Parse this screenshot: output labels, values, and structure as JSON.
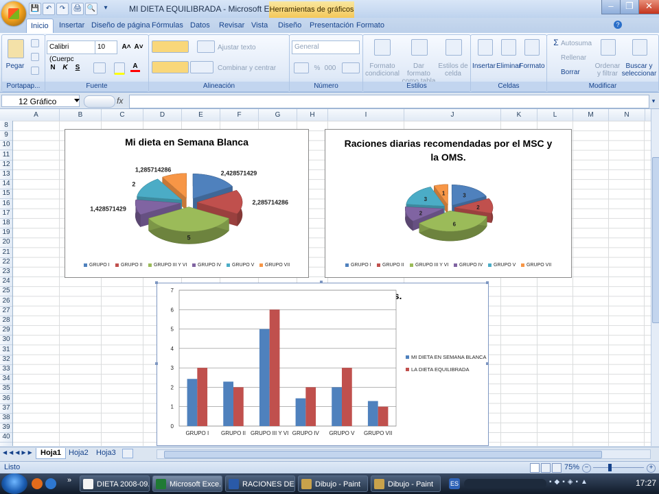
{
  "window": {
    "title": "MI DIETA EQUILIBRADA - Microsoft Excel",
    "contextual_tab": "Herramientas de gráficos",
    "minimize": "–",
    "restore": "❐",
    "close": "✕"
  },
  "qat": [
    "💾",
    "↶",
    "↷",
    "🖨",
    "🔍",
    "▾"
  ],
  "tabs": [
    "Inicio",
    "Insertar",
    "Diseño de página",
    "Fórmulas",
    "Datos",
    "Revisar",
    "Vista",
    "Diseño",
    "Presentación",
    "Formato"
  ],
  "ribbon": {
    "clipboard": {
      "label": "Portapap...",
      "paste": "Pegar"
    },
    "font": {
      "label": "Fuente",
      "font_name": "Calibri (Cuerpc",
      "font_size": "10",
      "grow": "A˄",
      "shrink": "A˅",
      "bold": "N",
      "italic": "K",
      "underline": "S"
    },
    "alignment": {
      "label": "Alineación",
      "wrap": "Ajustar texto",
      "merge": "Combinar y centrar"
    },
    "number": {
      "label": "Número",
      "format": "General",
      "percent": "%",
      "thousands": "000"
    },
    "styles": {
      "label": "Estilos",
      "cond_format": "Formato condicional",
      "table_format": "Dar formato como tabla",
      "cell_styles": "Estilos de celda"
    },
    "cells": {
      "label": "Celdas",
      "insert": "Insertar",
      "delete": "Eliminar",
      "format": "Formato"
    },
    "edit": {
      "label": "Modificar",
      "autosum": "Autosuma",
      "fill": "Rellenar",
      "clear": "Borrar",
      "sort": "Ordenar y filtrar",
      "find": "Buscar y seleccionar"
    }
  },
  "formula_bar": {
    "name_box": "12 Gráfico",
    "fx": "fx",
    "content": ""
  },
  "columns": [
    "A",
    "B",
    "C",
    "D",
    "E",
    "F",
    "G",
    "H",
    "I",
    "J",
    "K",
    "L",
    "M",
    "N"
  ],
  "rows": [
    "8",
    "9",
    "10",
    "11",
    "12",
    "13",
    "14",
    "15",
    "16",
    "17",
    "18",
    "19",
    "20",
    "21",
    "22",
    "23",
    "24",
    "25",
    "26",
    "27",
    "28",
    "29",
    "30",
    "31",
    "32",
    "33",
    "34",
    "35",
    "36",
    "37",
    "38",
    "39",
    "40"
  ],
  "colors": {
    "g1": "#4f81bd",
    "g2": "#c0504d",
    "g3": "#9bbb59",
    "g4": "#8064a2",
    "g5": "#4bacc6",
    "g6": "#f79646"
  },
  "chart_data": [
    {
      "type": "pie",
      "title": "Mi dieta en Semana Blanca",
      "categories": [
        "GRUPO I",
        "GRUPO II",
        "GRUPO III Y VI",
        "GRUPO IV",
        "GRUPO V",
        "GRUPO VII"
      ],
      "values": [
        2.428571429,
        2.285714286,
        5,
        1.428571429,
        2,
        1.285714286
      ],
      "data_labels": [
        "2,428571429",
        "2,285714286",
        "5",
        "1,428571429",
        "2",
        "1,285714286"
      ],
      "legend": "bottom",
      "style": "3d-exploded"
    },
    {
      "type": "pie",
      "title": "Raciones diarias recomendadas por el MSC y la OMS.",
      "categories": [
        "GRUPO I",
        "GRUPO II",
        "GRUPO III Y VI",
        "GRUPO IV",
        "GRUPO V",
        "GRUPO VII"
      ],
      "values": [
        3,
        2,
        6,
        2,
        3,
        1
      ],
      "data_labels": [
        "3",
        "2",
        "6",
        "2",
        "3",
        "1"
      ],
      "legend": "bottom",
      "style": "3d-exploded"
    },
    {
      "type": "bar",
      "title": "Comparando ambas dietas.",
      "categories": [
        "GRUPO I",
        "GRUPO II",
        "GRUPO III Y VI",
        "GRUPO IV",
        "GRUPO V",
        "GRUPO VII"
      ],
      "series": [
        {
          "name": "MI DIETA EN SEMANA BLANCA",
          "values": [
            2.43,
            2.29,
            5,
            1.43,
            2,
            1.29
          ]
        },
        {
          "name": "LA DIETA EQUILIBRADA",
          "values": [
            3,
            2,
            6,
            2,
            3,
            1
          ]
        }
      ],
      "ylim": [
        0,
        7
      ],
      "yticks": [
        "0",
        "1",
        "2",
        "3",
        "4",
        "5",
        "6",
        "7"
      ],
      "legend": "right",
      "grid": true
    }
  ],
  "sheet_tabs": [
    "Hoja1",
    "Hoja2",
    "Hoja3"
  ],
  "status": {
    "text": "Listo",
    "zoom": "75%"
  },
  "taskbar": {
    "items": [
      "DIETA 2008-09....",
      "Microsoft Exce...",
      "RACIONES DE ...",
      "Dibujo - Paint",
      "Dibujo - Paint"
    ],
    "clock": "17:27",
    "lang": "ES"
  }
}
